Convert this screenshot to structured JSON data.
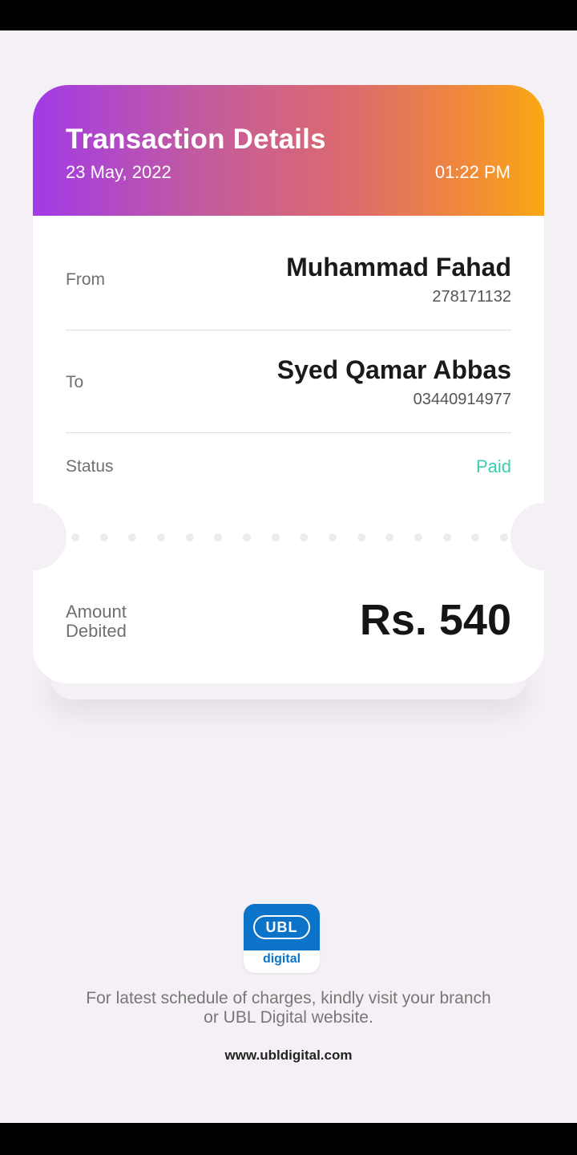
{
  "header": {
    "title": "Transaction Details",
    "date": "23 May, 2022",
    "time": "01:22 PM"
  },
  "from": {
    "label": "From",
    "name": "Muhammad Fahad",
    "account": "278171132"
  },
  "to": {
    "label": "To",
    "name": "Syed Qamar Abbas",
    "account": "03440914977"
  },
  "status": {
    "label": "Status",
    "value": "Paid"
  },
  "amount": {
    "label_line1": "Amount",
    "label_line2": "Debited",
    "value": "Rs. 540"
  },
  "logo": {
    "brand": "UBL",
    "sub": "digital"
  },
  "footer": {
    "note_line1": "For latest schedule of charges, kindly visit your branch",
    "note_line2": "or UBL Digital website.",
    "url": "www.ubldigital.com"
  },
  "colors": {
    "status_paid": "#3dcdb0",
    "brand_blue": "#0b73c8",
    "gradient_start": "#a23ae8",
    "gradient_end": "#f9a812"
  }
}
